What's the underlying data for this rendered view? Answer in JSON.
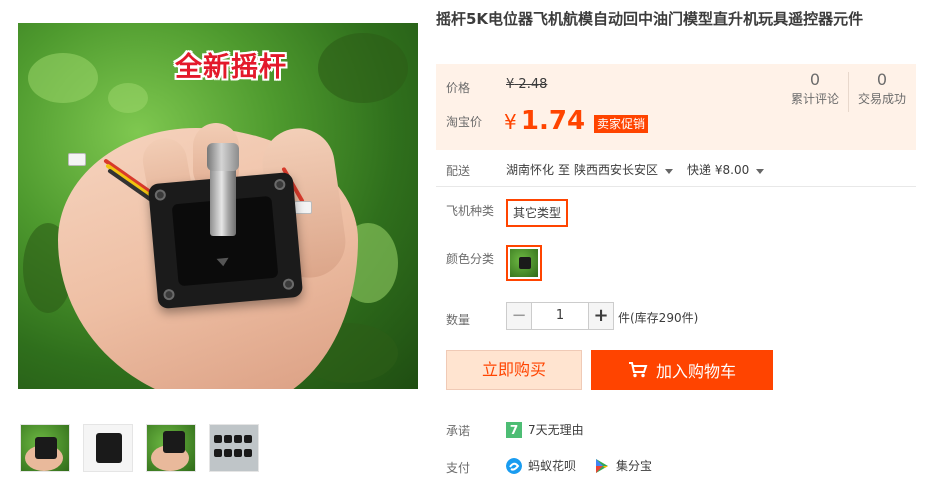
{
  "product": {
    "title": "摇杆5K电位器飞机航模自动回中油门模型直升机玩具遥控器元件",
    "image_overlay_text": "全新摇杆"
  },
  "price": {
    "label": "价格",
    "original_currency": "¥",
    "original_value": "2.48",
    "promo_label": "淘宝价",
    "promo_currency": "¥",
    "promo_value": "1.74",
    "promo_tag": "卖家促销",
    "accent_color": "#ff4400"
  },
  "stats": [
    {
      "count": "0",
      "label": "累计评论"
    },
    {
      "count": "0",
      "label": "交易成功"
    }
  ],
  "shipping": {
    "label": "配送",
    "from": "湖南怀化",
    "to_word": "至",
    "destination": "陕西西安长安区",
    "method": "快递 ¥8.00"
  },
  "sku": {
    "type_label": "飞机种类",
    "type_option": "其它类型",
    "color_label": "颜色分类"
  },
  "quantity": {
    "label": "数量",
    "minus": "−",
    "value": "1",
    "plus": "+",
    "stock_text": "件(库存290件)"
  },
  "actions": {
    "buy_now": "立即购买",
    "add_to_cart": "加入购物车"
  },
  "promise": {
    "label": "承诺",
    "icon_text": "7",
    "text": "7天无理由"
  },
  "payment": {
    "label": "支付",
    "methods": [
      "蚂蚁花呗",
      "集分宝"
    ]
  },
  "icons": {
    "cart": "shopping-cart-icon",
    "huabei": "huabei-icon",
    "jifenbao": "jifenbao-icon",
    "seven_day": "seven-day-return-icon"
  }
}
